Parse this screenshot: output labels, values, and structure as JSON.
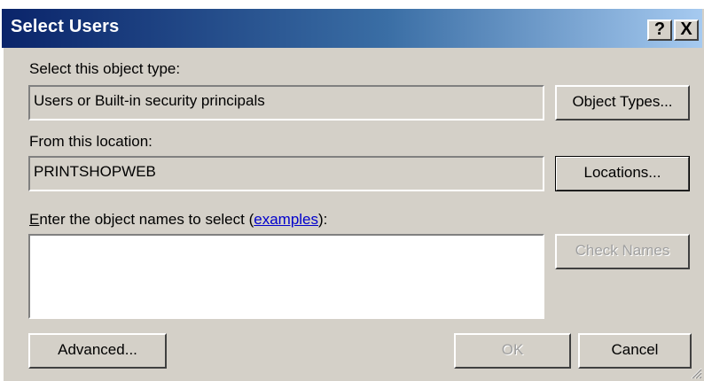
{
  "window": {
    "title": "Select Users",
    "help_glyph": "?",
    "close_glyph": "X"
  },
  "object_type": {
    "label": "Select this object type:",
    "value": "Users or Built-in security principals",
    "button": "Object Types..."
  },
  "location": {
    "label": "From this location:",
    "value": "PRINTSHOPWEB",
    "button": "Locations..."
  },
  "names": {
    "label_access_key": "E",
    "label_prefix": "nter the object names to select (",
    "link": "examples",
    "label_suffix": "):",
    "value": "",
    "check_button": "Check Names"
  },
  "footer": {
    "advanced": "Advanced...",
    "ok": "OK",
    "cancel": "Cancel"
  },
  "colors": {
    "face": "#d4d0c8",
    "title_start": "#0a246a",
    "title_end": "#a6caf0",
    "link": "#0000cc"
  }
}
